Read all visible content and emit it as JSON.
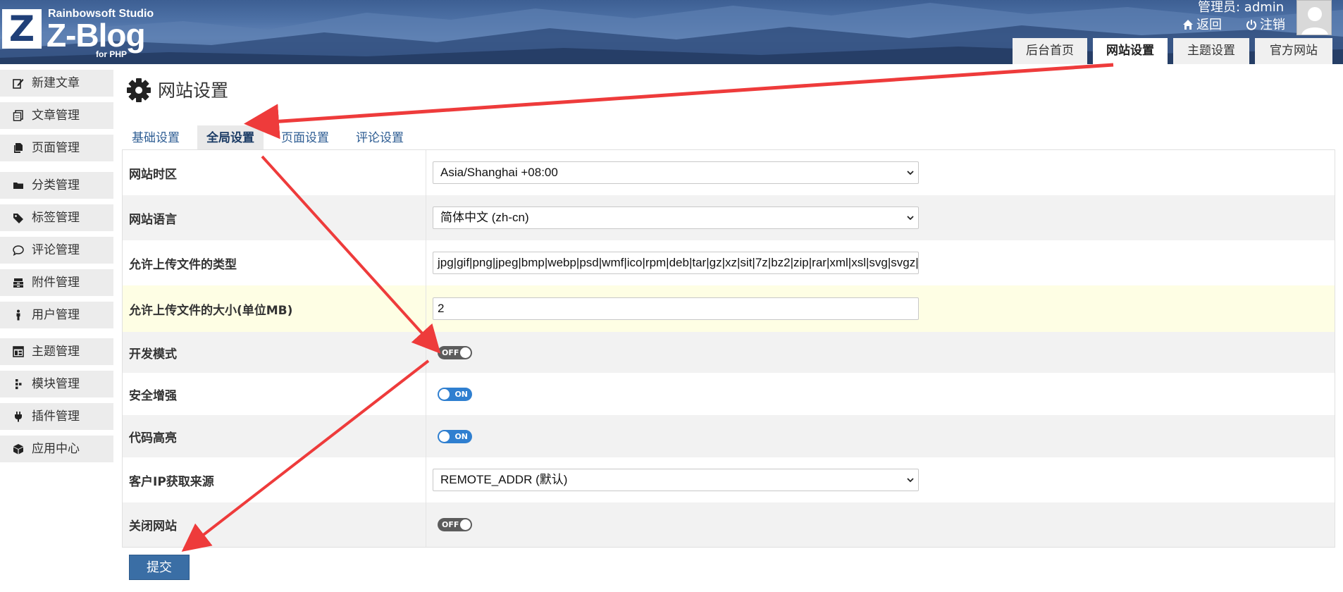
{
  "brand": {
    "studio": "Rainbowsoft Studio",
    "name": "Z-Blog",
    "suffix": "for PHP",
    "logo_letter": "Z"
  },
  "header": {
    "user_label": "管理员: admin",
    "links": [
      {
        "label": "返回",
        "icon": "home-icon"
      },
      {
        "label": "注销",
        "icon": "power-icon"
      }
    ],
    "tabs": [
      {
        "label": "后台首页",
        "active": false
      },
      {
        "label": "网站设置",
        "active": true
      },
      {
        "label": "主题设置",
        "active": false
      },
      {
        "label": "官方网站",
        "active": false
      }
    ]
  },
  "sidebar": {
    "items": [
      {
        "label": "新建文章",
        "icon": "edit-icon"
      },
      {
        "label": "文章管理",
        "icon": "documents-icon"
      },
      {
        "label": "页面管理",
        "icon": "copy-icon"
      },
      {
        "label": "分类管理",
        "icon": "folder-icon"
      },
      {
        "label": "标签管理",
        "icon": "tag-icon"
      },
      {
        "label": "评论管理",
        "icon": "comment-icon"
      },
      {
        "label": "附件管理",
        "icon": "attachment-box-icon"
      },
      {
        "label": "用户管理",
        "icon": "user-icon"
      },
      {
        "label": "主题管理",
        "icon": "layout-icon"
      },
      {
        "label": "模块管理",
        "icon": "module-icon"
      },
      {
        "label": "插件管理",
        "icon": "plugin-icon"
      },
      {
        "label": "应用中心",
        "icon": "package-icon"
      }
    ]
  },
  "page": {
    "title": "网站设置",
    "title_icon": "gear-icon",
    "subtabs": [
      {
        "label": "基础设置",
        "active": false
      },
      {
        "label": "全局设置",
        "active": true
      },
      {
        "label": "页面设置",
        "active": false
      },
      {
        "label": "评论设置",
        "active": false
      }
    ]
  },
  "settings": {
    "timezone": {
      "label": "网站时区",
      "value": "Asia/Shanghai +08:00"
    },
    "language": {
      "label": "网站语言",
      "value": "简体中文 (zh-cn)"
    },
    "upload_types": {
      "label": "允许上传文件的类型",
      "value": "jpg|gif|png|jpeg|bmp|webp|psd|wmf|ico|rpm|deb|tar|gz|xz|sit|7z|bz2|zip|rar|xml|xsl|svg|svgz|rtf|doc"
    },
    "upload_size": {
      "label": "允许上传文件的大小(单位MB)",
      "value": "2"
    },
    "dev_mode": {
      "label": "开发模式",
      "state": "OFF"
    },
    "security": {
      "label": "安全增强",
      "state": "ON"
    },
    "code_highlight": {
      "label": "代码高亮",
      "state": "ON"
    },
    "client_ip": {
      "label": "客户IP获取来源",
      "value": "REMOTE_ADDR (默认)"
    },
    "close_site": {
      "label": "关闭网站",
      "state": "OFF"
    }
  },
  "submit_label": "提交",
  "colors": {
    "accent": "#3a6ea5",
    "annotation_arrow": "#ee3b3b",
    "toggle_on": "#2f7fd0",
    "toggle_off": "#5c5c5c",
    "header_bg": "#4a6ea3"
  }
}
